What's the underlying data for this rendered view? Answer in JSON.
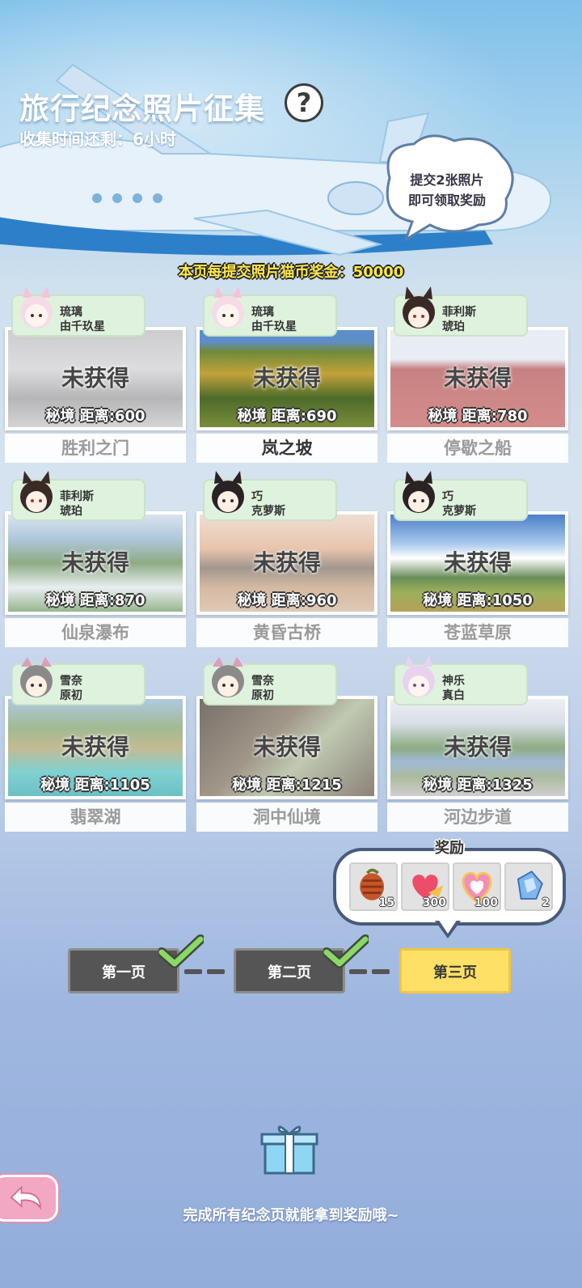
{
  "header": {
    "title": "旅行纪念照片征集",
    "help_label": "?",
    "subtitle": "收集时间还剩：6小时",
    "bubble_line1": "提交2张照片",
    "bubble_line2": "即可领取奖励",
    "bonus": "本页每提交照片猫币奖金：50000"
  },
  "cards": [
    {
      "tag1": "琉璃",
      "tag2": "由千玖星",
      "status": "未获得",
      "distance": "秘境  距离:600",
      "place": "胜利之门"
    },
    {
      "tag1": "琉璃",
      "tag2": "由千玖星",
      "status": "未获得",
      "distance": "秘境  距离:690",
      "place": "岚之坡"
    },
    {
      "tag1": "菲利斯",
      "tag2": "琥珀",
      "status": "未获得",
      "distance": "秘境  距离:780",
      "place": "停歇之船"
    },
    {
      "tag1": "菲利斯",
      "tag2": "琥珀",
      "status": "未获得",
      "distance": "秘境  距离:870",
      "place": "仙泉瀑布"
    },
    {
      "tag1": "巧",
      "tag2": "克萝斯",
      "status": "未获得",
      "distance": "秘境  距离:960",
      "place": "黄昏古桥"
    },
    {
      "tag1": "巧",
      "tag2": "克萝斯",
      "status": "未获得",
      "distance": "秘境  距离:1050",
      "place": "苍蓝草原"
    },
    {
      "tag1": "雪奈",
      "tag2": "原初",
      "status": "未获得",
      "distance": "秘境  距离:1105",
      "place": "翡翠湖"
    },
    {
      "tag1": "雪奈",
      "tag2": "原初",
      "status": "未获得",
      "distance": "秘境  距离:1215",
      "place": "洞中仙境"
    },
    {
      "tag1": "神乐",
      "tag2": "真白",
      "status": "未获得",
      "distance": "秘境  距离:1325",
      "place": "河边步道"
    }
  ],
  "rewards": {
    "title": "奖励",
    "items": [
      {
        "icon": "pinecone-icon",
        "count": "15"
      },
      {
        "icon": "heart-wing-icon",
        "count": "300"
      },
      {
        "icon": "heart-badge-icon",
        "count": "100"
      },
      {
        "icon": "crystal-icon",
        "count": "2"
      }
    ]
  },
  "pages": {
    "p1": "第一页",
    "p2": "第二页",
    "p3": "第三页"
  },
  "footer": {
    "text": "完成所有纪念页就能拿到奖励哦~"
  },
  "colors": {
    "tag_bg": "#dff2de",
    "current_page": "#ffe066",
    "done_page": "#555555",
    "bonus_text": "#ffe84a"
  }
}
